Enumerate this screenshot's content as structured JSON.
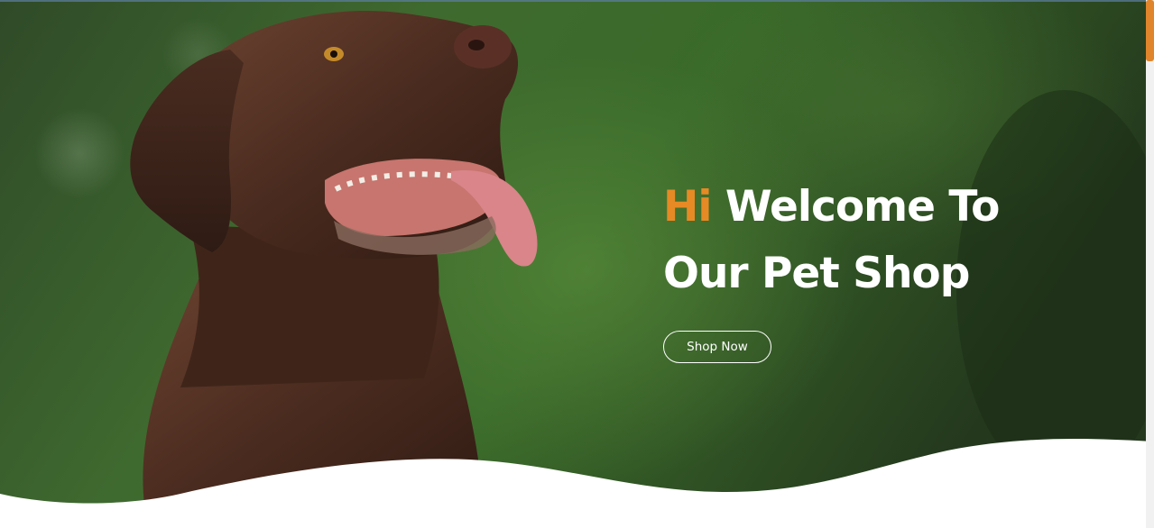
{
  "hero": {
    "accent_color": "#e68a25",
    "background_image": "chocolate-labrador-photo",
    "title_accent": "Hi",
    "title_line1_rest": "Welcome To",
    "title_line2": "Our Pet Shop",
    "cta_label": "Shop Now"
  },
  "scrollbar": {
    "thumb_color": "#e0852b"
  }
}
